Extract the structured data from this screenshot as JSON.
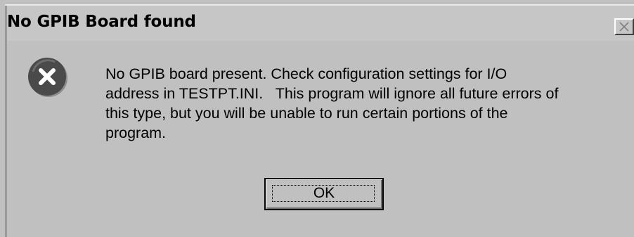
{
  "window": {
    "title": "No GPIB Board found",
    "close_icon": "close-icon"
  },
  "message": {
    "icon": "error-icon",
    "text": "No GPIB board present. Check configuration settings for I/O\naddress in TESTPT.INI.   This program will ignore all future errors of\nthis type, but you will be unable to run certain portions of the\nprogram."
  },
  "buttons": {
    "ok_label": "OK"
  },
  "colors": {
    "dialog_background": "#c0c0c0",
    "icon_fill": "#4a4a4a"
  }
}
